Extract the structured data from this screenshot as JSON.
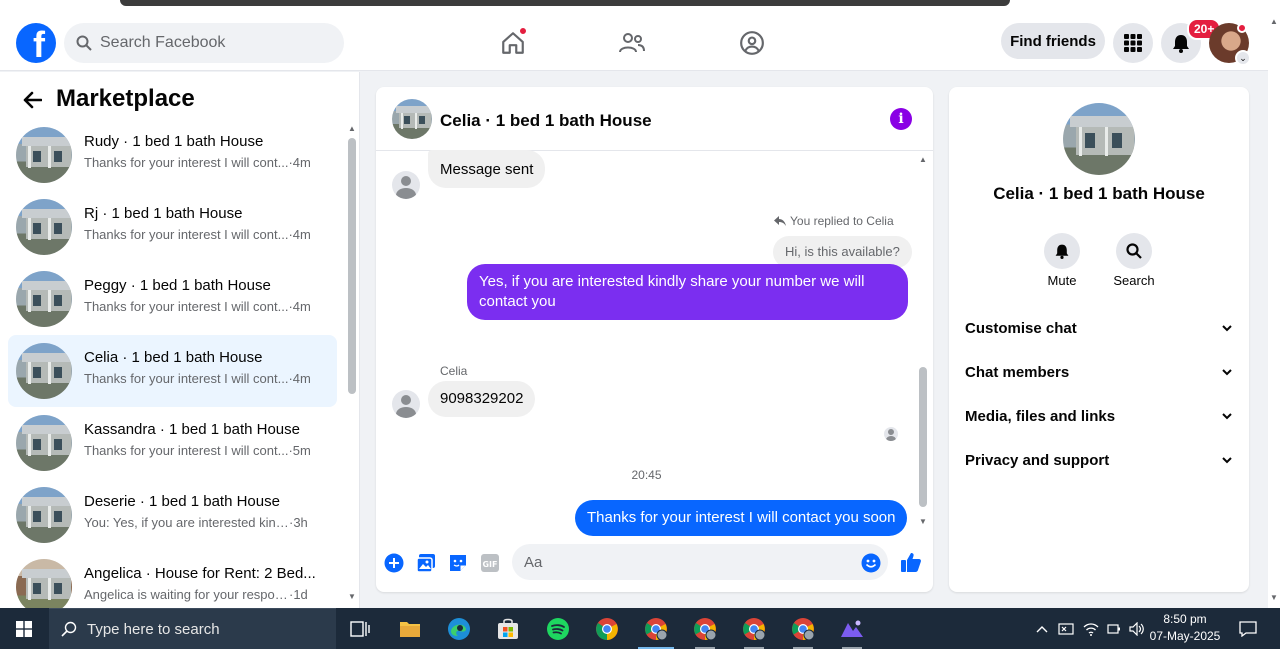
{
  "header": {
    "search_placeholder": "Search Facebook",
    "find_friends_label": "Find friends",
    "notification_count": "20+"
  },
  "sidebar": {
    "title": "Marketplace",
    "conversations": [
      {
        "title": "Rudy · 1 bed 1 bath House",
        "preview": "Thanks for your interest I will cont...",
        "time": "·4m",
        "active": false
      },
      {
        "title": "Rj · 1 bed 1 bath House",
        "preview": "Thanks for your interest I will cont...",
        "time": "·4m",
        "active": false
      },
      {
        "title": "Peggy · 1 bed 1 bath House",
        "preview": "Thanks for your interest I will cont...",
        "time": "·4m",
        "active": false
      },
      {
        "title": "Celia · 1 bed 1 bath House",
        "preview": "Thanks for your interest I will cont...",
        "time": "·4m",
        "active": true
      },
      {
        "title": "Kassandra · 1 bed 1 bath House",
        "preview": "Thanks for your interest I will cont...",
        "time": "·5m",
        "active": false
      },
      {
        "title": "Deserie · 1 bed 1 bath House",
        "preview": "You: Yes, if you are interested kindl...",
        "time": "·3h",
        "active": false
      },
      {
        "title": "Angelica · House for Rent: 2 Bed...",
        "preview": "Angelica is waiting for your respon...",
        "time": "·1d",
        "active": false
      }
    ]
  },
  "chat": {
    "title": "Celia · 1 bed 1 bath House",
    "messages": {
      "sent_notice": "Message sent",
      "replied_label": "You replied to Celia",
      "quoted_text": "Hi, is this available?",
      "my_reply": "Yes, if you are interested kindly share your number we will contact you",
      "sender_name": "Celia",
      "their_number": "9098329202",
      "timestamp": "20:45",
      "last_message": "Thanks for your interest I will contact you soon"
    },
    "composer_placeholder": "Aa"
  },
  "details": {
    "title": "Celia · 1 bed 1 bath House",
    "mute_label": "Mute",
    "search_label": "Search",
    "sections": [
      "Customise chat",
      "Chat members",
      "Media, files and links",
      "Privacy and support"
    ]
  },
  "taskbar": {
    "search_placeholder": "Type here to search",
    "time": "8:50 pm",
    "date": "07-May-2025"
  },
  "colors": {
    "facebook_blue": "#0866ff",
    "purple_bubble": "#7b2ef0",
    "info_purple": "#8a00e5",
    "notification_red": "#e41e3f"
  }
}
